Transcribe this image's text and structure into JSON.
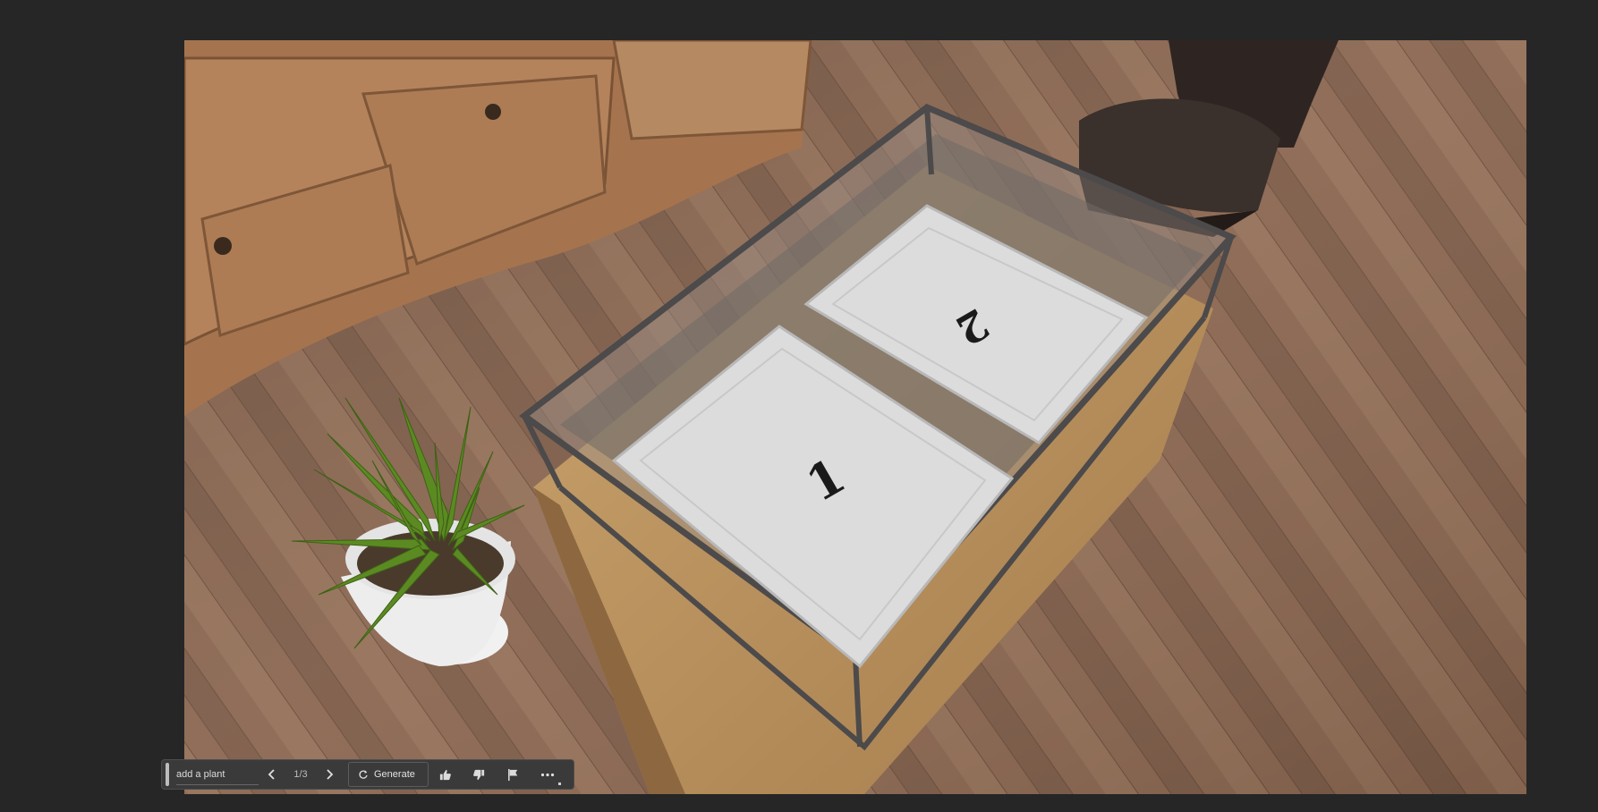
{
  "canvas": {
    "tray_labels": [
      "1",
      "2"
    ]
  },
  "taskbar": {
    "prompt_value": "add a plant",
    "counter": "1/3",
    "generate_label": "Generate",
    "icons": [
      "prev-arrow-icon",
      "next-arrow-icon",
      "regenerate-icon",
      "thumbs-up-icon",
      "thumbs-down-icon",
      "flag-icon",
      "more-icon"
    ]
  }
}
